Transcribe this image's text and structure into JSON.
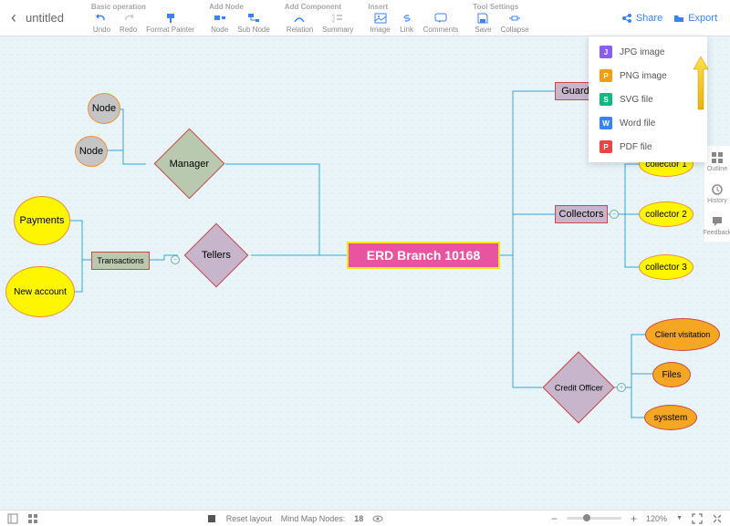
{
  "header": {
    "title": "untitled",
    "groups": {
      "basic": {
        "label": "Basic operation",
        "undo": "Undo",
        "redo": "Redo",
        "format": "Format Painter"
      },
      "addnode": {
        "label": "Add Node",
        "node": "Node",
        "subnode": "Sub Node"
      },
      "addcomp": {
        "label": "Add Component",
        "relation": "Relation",
        "summary": "Summary"
      },
      "insert": {
        "label": "Insert",
        "image": "Image",
        "link": "Link",
        "comments": "Comments"
      },
      "toolset": {
        "label": "Tool Settings",
        "save": "Save",
        "collapse": "Collapse"
      }
    },
    "share": "Share",
    "export": "Export"
  },
  "export_menu": {
    "jpg": "JPG image",
    "png": "PNG image",
    "svg": "SVG file",
    "word": "Word file",
    "pdf": "PDF file"
  },
  "sidebar": {
    "outline": "Outline",
    "history": "History",
    "feedback": "Feedback"
  },
  "diagram": {
    "central": "ERD Branch 10168",
    "manager": "Manager",
    "tellers": "Tellers",
    "guard": "Guard",
    "collectors": "Collectors",
    "creditofficer": "Credit Officer",
    "node1": "Node",
    "node2": "Node",
    "transactions": "Transactions",
    "payments": "Payments",
    "newaccount": "New account",
    "collector1": "collector 1",
    "collector2": "collector 2",
    "collector3": "collector 3",
    "clientvisit": "Client visitation",
    "files": "Files",
    "sysstem": "sysstem"
  },
  "status": {
    "reset": "Reset layout",
    "nodes_label": "Mind Map Nodes:",
    "nodes_count": "18",
    "zoom": "120%",
    "minus": "−",
    "plus": "+"
  }
}
